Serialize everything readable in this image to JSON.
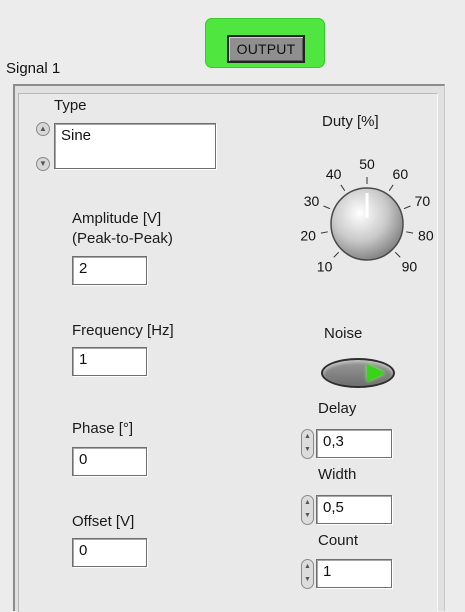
{
  "output_button": {
    "label": "OUTPUT",
    "active_color": "#4fe640"
  },
  "cluster": {
    "title": "Signal 1"
  },
  "type": {
    "label": "Type",
    "value": "Sine"
  },
  "amplitude": {
    "label_line1": "Amplitude [V]",
    "label_line2": "(Peak-to-Peak)",
    "value": "2"
  },
  "frequency": {
    "label": "Frequency [Hz]",
    "value": "1"
  },
  "phase": {
    "label": "Phase [°]",
    "value": "0"
  },
  "offset": {
    "label": "Offset [V]",
    "value": "0"
  },
  "duty": {
    "label": "Duty [%]",
    "value": 50,
    "scale": [
      "10",
      "20",
      "30",
      "40",
      "50",
      "60",
      "70",
      "80",
      "90"
    ]
  },
  "noise": {
    "label": "Noise",
    "state": "off"
  },
  "delay": {
    "label": "Delay",
    "value": "0,3"
  },
  "width": {
    "label": "Width",
    "value": "0,5"
  },
  "count": {
    "label": "Count",
    "value": "1"
  }
}
